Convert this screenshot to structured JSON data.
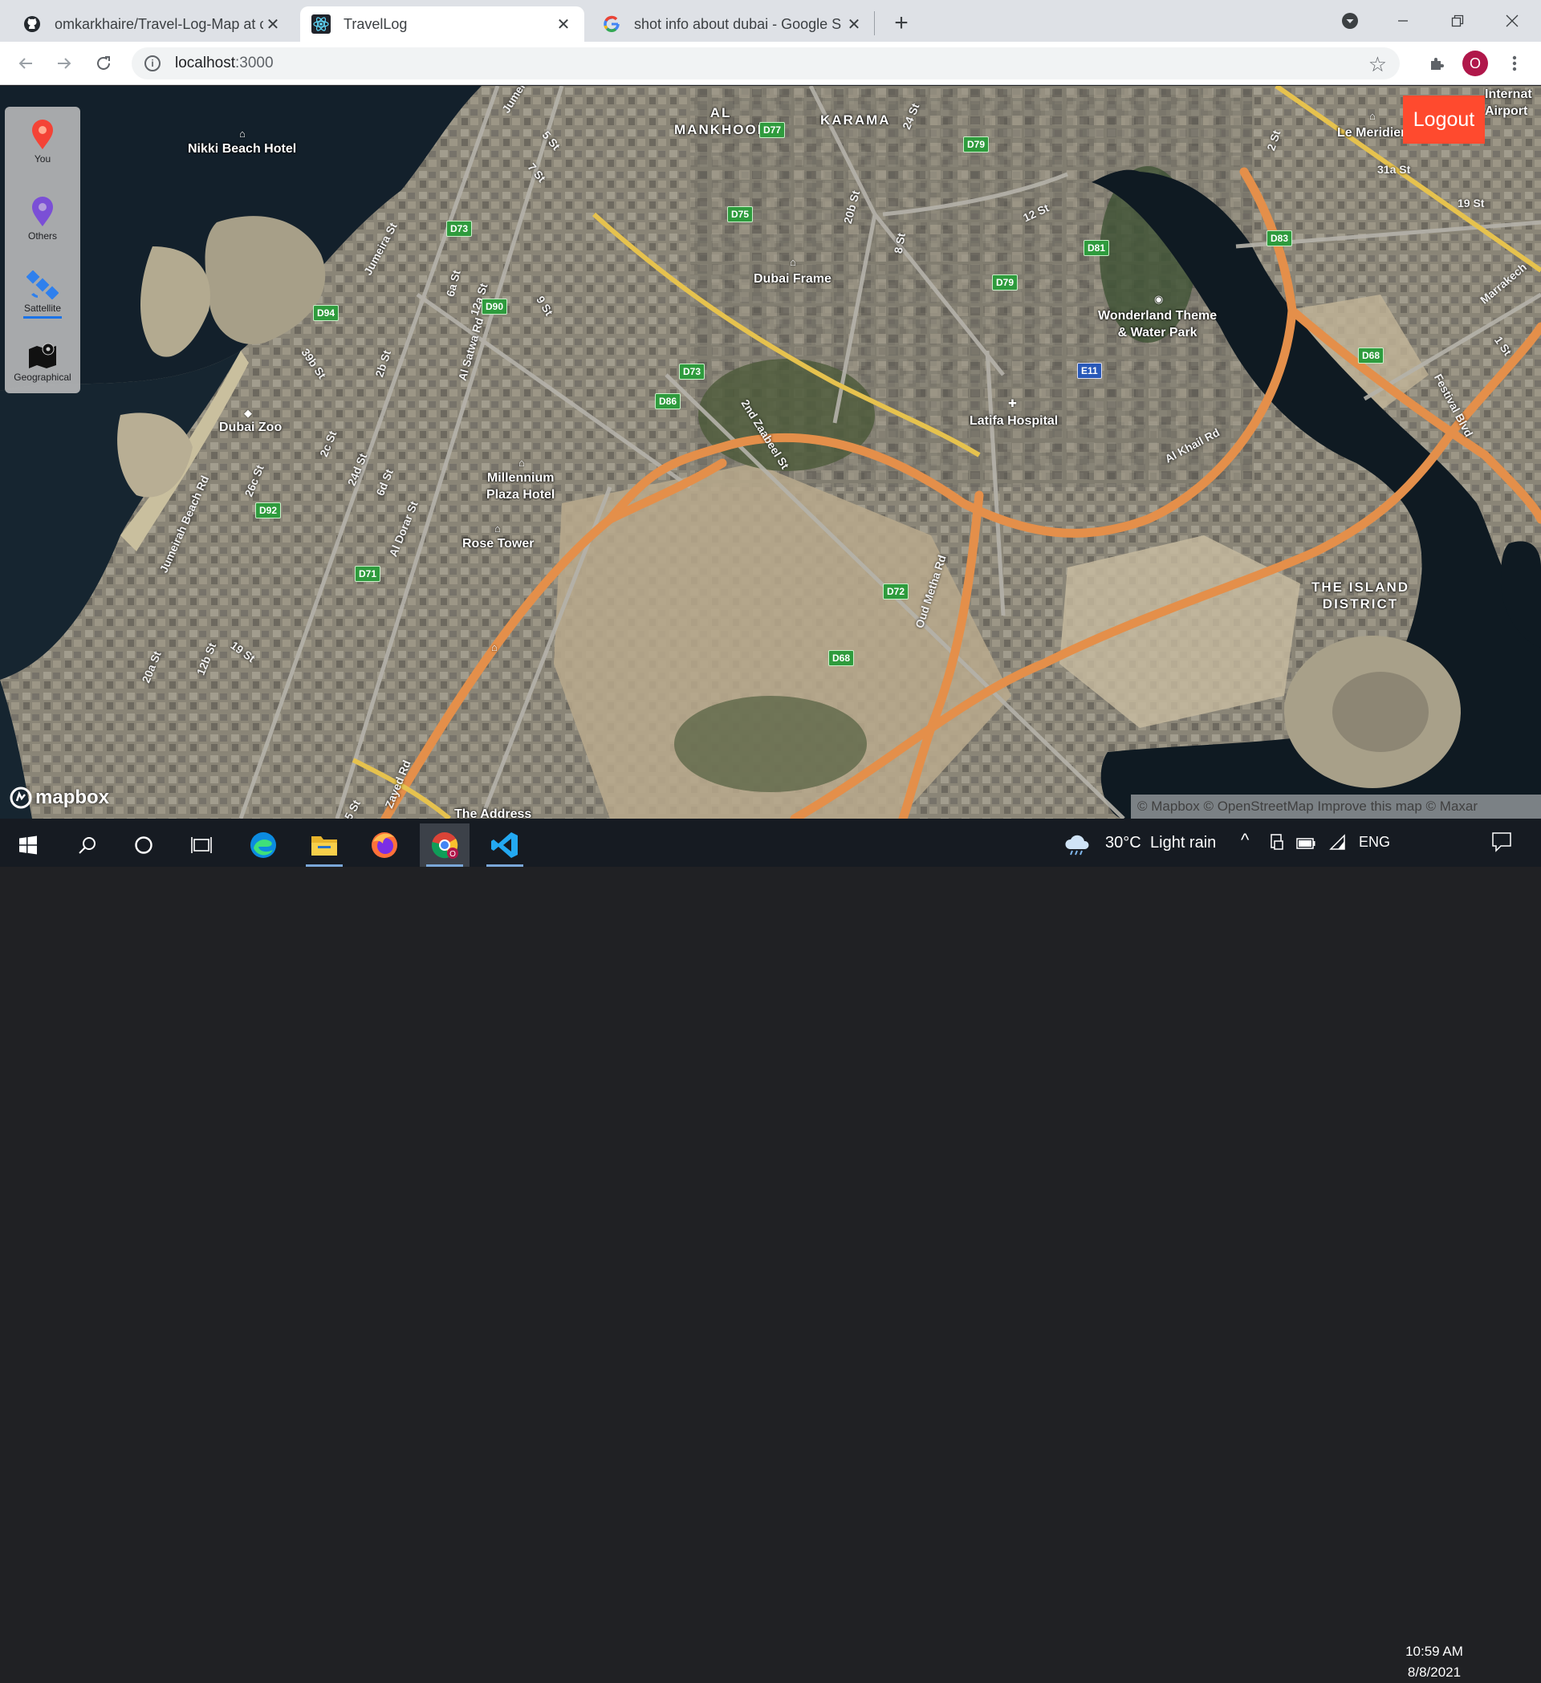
{
  "browser": {
    "tabs": [
      {
        "title": "omkarkhaire/Travel-Log-Map at c",
        "icon": "github-icon"
      },
      {
        "title": "TravelLog",
        "icon": "react-icon",
        "active": true
      },
      {
        "title": "shot info about dubai - Google S",
        "icon": "google-icon"
      }
    ],
    "url_host": "localhost",
    "url_port": ":3000",
    "profile_initial": "O"
  },
  "sidebar": {
    "items": [
      {
        "label": "You",
        "icon": "map-pin-red-icon",
        "color": "#f44336"
      },
      {
        "label": "Others",
        "icon": "map-pin-purple-icon",
        "color": "#7b4fd6"
      },
      {
        "label": "Sattellite",
        "icon": "satellite-icon",
        "color": "#2f80ed",
        "selected": true
      },
      {
        "label": "Geographical",
        "icon": "map-icon",
        "color": "#111111"
      }
    ]
  },
  "logout_label": "Logout",
  "map": {
    "labels": {
      "al_mankhool": "AL\nMANKHOOL",
      "karama": "KARAMA",
      "nikki_beach": "Nikki Beach Hotel",
      "dubai_frame": "Dubai Frame",
      "wonderland": "Wonderland Theme\n& Water Park",
      "latifa": "Latifa Hospital",
      "dubai_zoo": "Dubai Zoo",
      "millennium": "Millennium\nPlaza Hotel",
      "rose_tower": "Rose Tower",
      "the_address": "The Address",
      "island_district": "THE ISLAND\nDISTRICT",
      "le_meridien": "Le Meridien",
      "airport": "Internat\nAirport"
    },
    "streets": [
      "Jumeira St",
      "5 St",
      "7 St",
      "24 St",
      "20b St",
      "12 St",
      "8 St",
      "Jumeira St",
      "6a St",
      "12a St",
      "9 St",
      "Al Satwa Rd",
      "39b St",
      "2b St",
      "2nd Zaabeel St",
      "Al Khail Rd",
      "Festival Blvd",
      "Marrakech",
      "1 St",
      "2 St",
      "31a St",
      "19 St",
      "Jumeirah Beach Rd",
      "26c St",
      "2c St",
      "24d St",
      "6d St",
      "Al Dorar St",
      "20a St",
      "19 St",
      "12b St",
      "Oud Metha Rd",
      "Zayed Rd",
      "5 St"
    ],
    "shields": [
      "D77",
      "D79",
      "D75",
      "D73",
      "D81",
      "D79",
      "D83",
      "D94",
      "D90",
      "D73",
      "D86",
      "D68",
      "D92",
      "D71",
      "D72",
      "D68"
    ],
    "shield_e11": "E11",
    "brand": "mapbox",
    "attribution": "© Mapbox © OpenStreetMap Improve this map © Maxar"
  },
  "taskbar": {
    "weather_temp": "30°C",
    "weather_desc": "Light rain",
    "language": "ENG",
    "time": "10:59 AM",
    "date": "8/8/2021"
  }
}
